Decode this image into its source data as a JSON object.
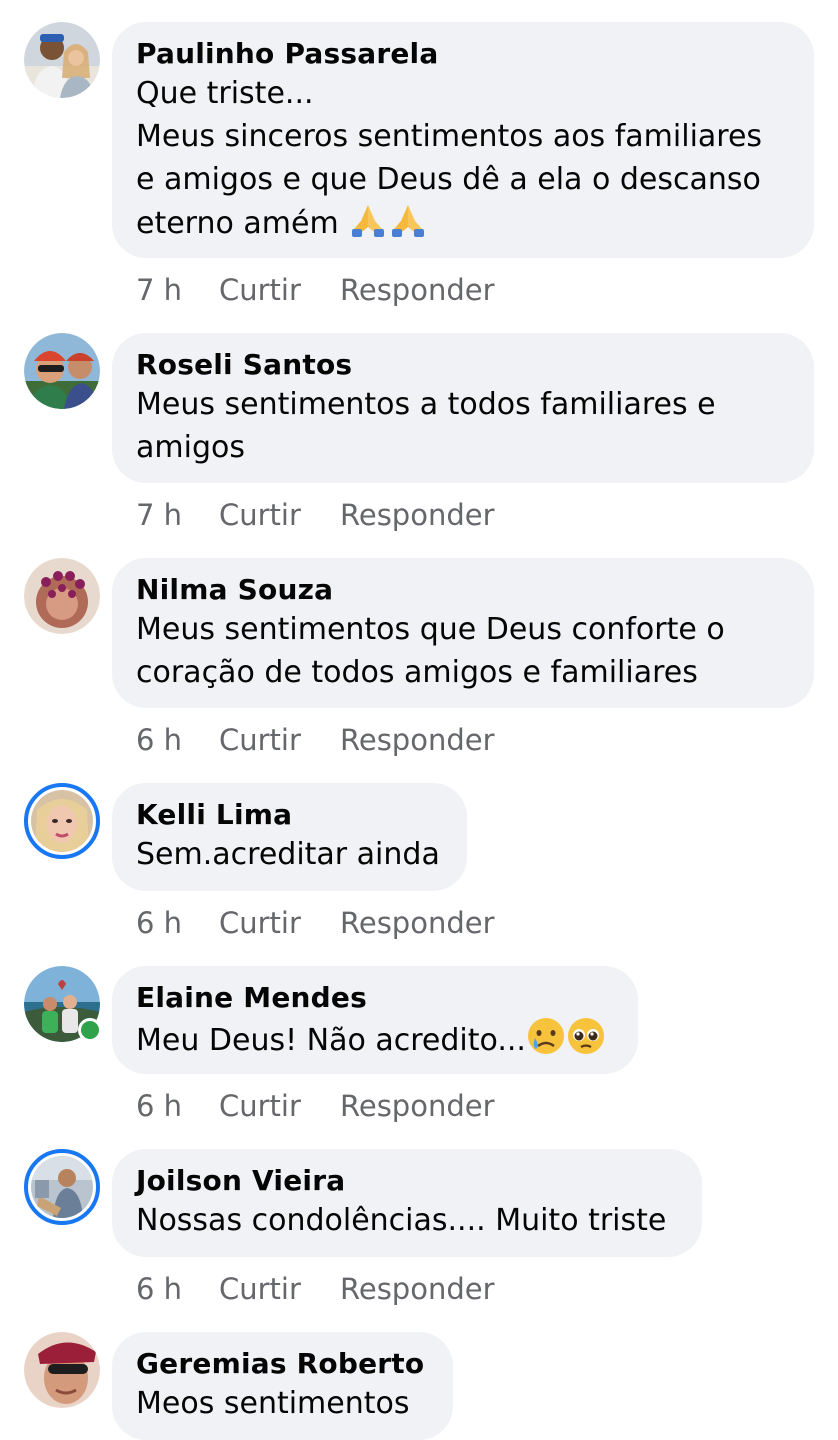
{
  "comments": [
    {
      "author": "Paulinho Passarela",
      "text": "Que triste...\nMeus sinceros sentimentos aos familiares e amigos e que Deus dê a ela o descanso eterno amém",
      "emoji": [
        "folded-hands-icon",
        "folded-hands-icon"
      ],
      "time": "7 h",
      "like": "Curtir",
      "reply": "Responder"
    },
    {
      "author": "Roseli Santos",
      "text": "Meus sentimentos a todos familiares e\namigos",
      "time": "7 h",
      "like": "Curtir",
      "reply": "Responder"
    },
    {
      "author": "Nilma Souza",
      "text": "Meus sentimentos que Deus conforte o\ncoração de todos amigos e familiares",
      "time": "6 h",
      "like": "Curtir",
      "reply": "Responder"
    },
    {
      "author": "Kelli Lima",
      "text": "Sem.acreditar ainda",
      "time": "6 h",
      "like": "Curtir",
      "reply": "Responder"
    },
    {
      "author": "Elaine Mendes",
      "text": "Meu Deus! Não acredito...",
      "emoji": [
        "sad-tear-face-icon",
        "pleading-face-icon"
      ],
      "time": "6 h",
      "like": "Curtir",
      "reply": "Responder"
    },
    {
      "author": "Joilson Vieira",
      "text": "Nossas condolências.... Muito triste",
      "time": "6 h",
      "like": "Curtir",
      "reply": "Responder"
    },
    {
      "author": "Geremias Roberto",
      "text": "Meos sentimentos"
    }
  ],
  "colors": {
    "bubble": "#f0f2f5",
    "meta_text": "#65676b",
    "story_ring": "#1877f2",
    "online": "#31a24c"
  }
}
